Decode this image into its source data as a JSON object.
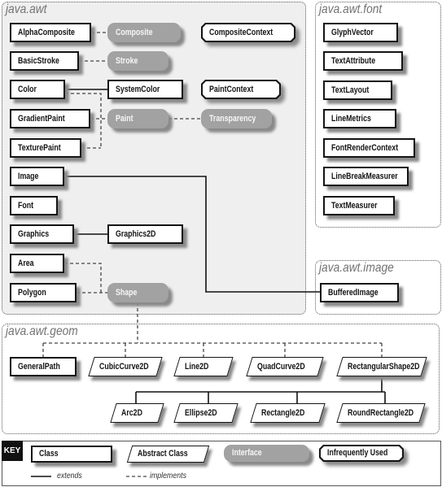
{
  "packages": {
    "awt": {
      "title": "java.awt",
      "nodes": {
        "alpha_composite": {
          "label": "AlphaComposite",
          "kind": "class"
        },
        "composite": {
          "label": "Composite",
          "kind": "interface"
        },
        "composite_context": {
          "label": "CompositeContext",
          "kind": "infrequently-used"
        },
        "basic_stroke": {
          "label": "BasicStroke",
          "kind": "class"
        },
        "stroke": {
          "label": "Stroke",
          "kind": "interface"
        },
        "color": {
          "label": "Color",
          "kind": "class"
        },
        "system_color": {
          "label": "SystemColor",
          "kind": "class"
        },
        "paint_context": {
          "label": "PaintContext",
          "kind": "infrequently-used"
        },
        "gradient_paint": {
          "label": "GradientPaint",
          "kind": "class"
        },
        "paint": {
          "label": "Paint",
          "kind": "interface"
        },
        "transparency": {
          "label": "Transparency",
          "kind": "interface"
        },
        "texture_paint": {
          "label": "TexturePaint",
          "kind": "class"
        },
        "image": {
          "label": "Image",
          "kind": "class"
        },
        "font": {
          "label": "Font",
          "kind": "class"
        },
        "graphics": {
          "label": "Graphics",
          "kind": "class"
        },
        "graphics2d": {
          "label": "Graphics2D",
          "kind": "class"
        },
        "area": {
          "label": "Area",
          "kind": "class"
        },
        "polygon": {
          "label": "Polygon",
          "kind": "class"
        },
        "shape": {
          "label": "Shape",
          "kind": "interface"
        }
      }
    },
    "font": {
      "title": "java.awt.font",
      "nodes": {
        "glyph_vector": {
          "label": "GlyphVector",
          "kind": "class"
        },
        "text_attribute": {
          "label": "TextAttribute",
          "kind": "class"
        },
        "text_layout": {
          "label": "TextLayout",
          "kind": "class"
        },
        "line_metrics": {
          "label": "LineMetrics",
          "kind": "class"
        },
        "font_render_context": {
          "label": "FontRenderContext",
          "kind": "class"
        },
        "line_break_measurer": {
          "label": "LineBreakMeasurer",
          "kind": "class"
        },
        "text_measurer": {
          "label": "TextMeasurer",
          "kind": "class"
        }
      }
    },
    "image": {
      "title": "java.awt.image",
      "nodes": {
        "buffered_image": {
          "label": "BufferedImage",
          "kind": "class"
        }
      }
    },
    "geom": {
      "title": "java.awt.geom",
      "nodes": {
        "general_path": {
          "label": "GeneralPath",
          "kind": "class"
        },
        "cubic_curve_2d": {
          "label": "CubicCurve2D",
          "kind": "abstract-class"
        },
        "line_2d": {
          "label": "Line2D",
          "kind": "abstract-class"
        },
        "quad_curve_2d": {
          "label": "QuadCurve2D",
          "kind": "abstract-class"
        },
        "rectangular_shape_2d": {
          "label": "RectangularShape2D",
          "kind": "abstract-class"
        },
        "arc_2d": {
          "label": "Arc2D",
          "kind": "abstract-class"
        },
        "ellipse_2d": {
          "label": "Ellipse2D",
          "kind": "abstract-class"
        },
        "rectangle_2d": {
          "label": "Rectangle2D",
          "kind": "abstract-class"
        },
        "round_rectangle_2d": {
          "label": "RoundRectangle2D",
          "kind": "abstract-class"
        }
      }
    }
  },
  "relations": [
    {
      "from": "AlphaComposite",
      "to": "Composite",
      "type": "implements"
    },
    {
      "from": "BasicStroke",
      "to": "Stroke",
      "type": "implements"
    },
    {
      "from": "SystemColor",
      "to": "Color",
      "type": "extends"
    },
    {
      "from": "Color",
      "to": "Paint",
      "type": "implements"
    },
    {
      "from": "GradientPaint",
      "to": "Paint",
      "type": "implements"
    },
    {
      "from": "TexturePaint",
      "to": "Paint",
      "type": "implements"
    },
    {
      "from": "Paint",
      "to": "Transparency",
      "type": "implements"
    },
    {
      "from": "BufferedImage",
      "to": "Image",
      "type": "extends"
    },
    {
      "from": "Graphics2D",
      "to": "Graphics",
      "type": "extends"
    },
    {
      "from": "Area",
      "to": "Shape",
      "type": "implements"
    },
    {
      "from": "Polygon",
      "to": "Shape",
      "type": "implements"
    },
    {
      "from": "GeneralPath",
      "to": "Shape",
      "type": "implements"
    },
    {
      "from": "CubicCurve2D",
      "to": "Shape",
      "type": "implements"
    },
    {
      "from": "Line2D",
      "to": "Shape",
      "type": "implements"
    },
    {
      "from": "QuadCurve2D",
      "to": "Shape",
      "type": "implements"
    },
    {
      "from": "RectangularShape2D",
      "to": "Shape",
      "type": "implements"
    },
    {
      "from": "Arc2D",
      "to": "RectangularShape2D",
      "type": "extends"
    },
    {
      "from": "Ellipse2D",
      "to": "RectangularShape2D",
      "type": "extends"
    },
    {
      "from": "Rectangle2D",
      "to": "RectangularShape2D",
      "type": "extends"
    },
    {
      "from": "RoundRectangle2D",
      "to": "RectangularShape2D",
      "type": "extends"
    }
  ],
  "key": {
    "title": "KEY",
    "class": "Class",
    "abstract_class": "Abstract Class",
    "interface": "Interface",
    "infrequently_used": "Infrequently Used",
    "extends": "extends",
    "implements": "implements"
  },
  "colors": {
    "awt_panel_fill": "#efefef",
    "interface_fill": "#a2a2a2",
    "shadow": "#8a8a8a",
    "title_text": "#727272"
  }
}
